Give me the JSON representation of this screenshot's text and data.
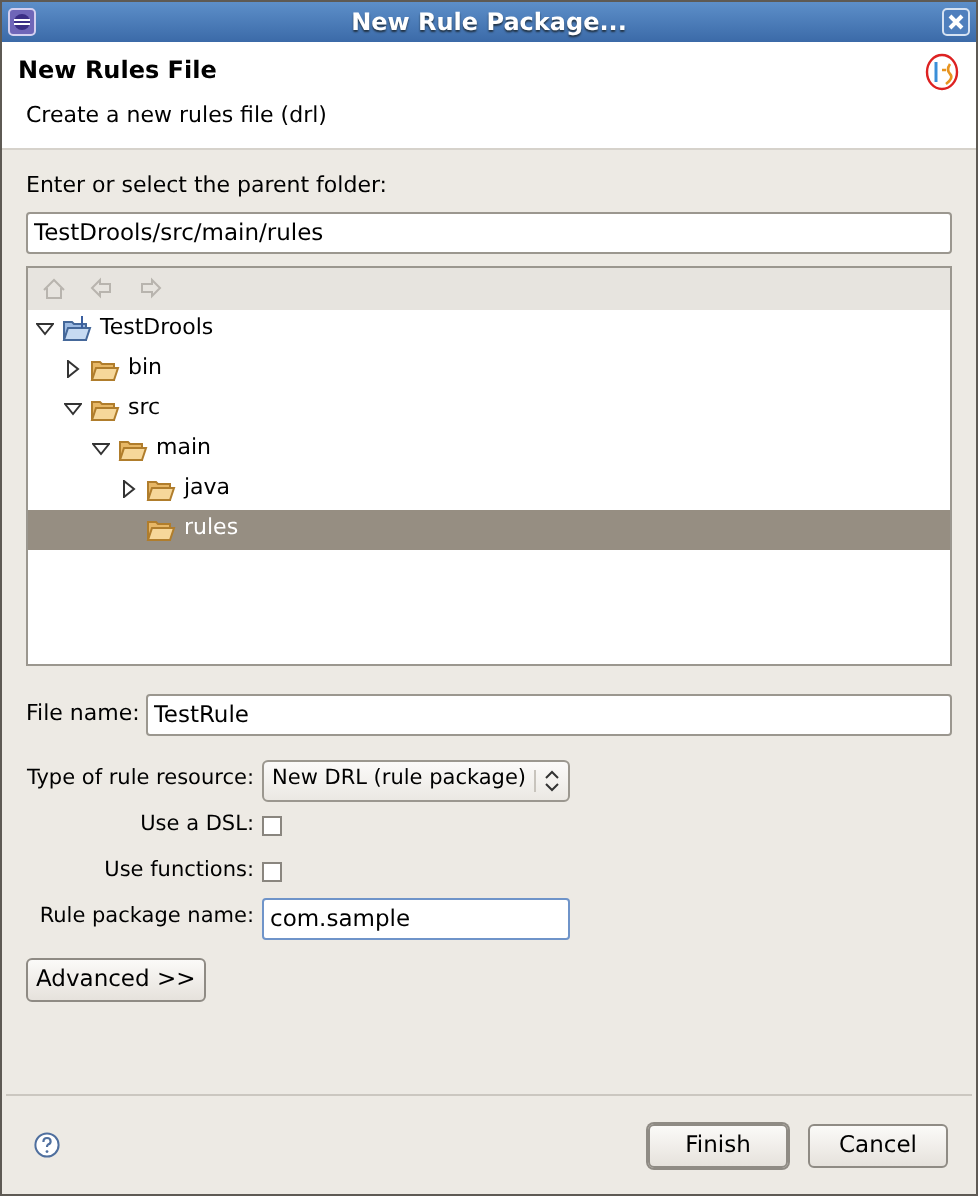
{
  "window": {
    "title": "New Rule Package..."
  },
  "header": {
    "title": "New Rules File",
    "description": "Create a new rules file (drl)"
  },
  "folder": {
    "label": "Enter or select the parent folder:",
    "value": "TestDrools/src/main/rules"
  },
  "tree": [
    {
      "label": "TestDrools",
      "kind": "project",
      "expanded": true,
      "selected": false,
      "children": [
        {
          "label": "bin",
          "kind": "folder",
          "expanded": false,
          "selected": false
        },
        {
          "label": "src",
          "kind": "folder",
          "expanded": true,
          "selected": false,
          "children": [
            {
              "label": "main",
              "kind": "folder",
              "expanded": true,
              "selected": false,
              "children": [
                {
                  "label": "java",
                  "kind": "folder",
                  "expanded": false,
                  "selected": false
                },
                {
                  "label": "rules",
                  "kind": "folder",
                  "selected": true
                }
              ]
            }
          ]
        }
      ]
    }
  ],
  "file_name": {
    "label": "File name:",
    "value": "TestRule"
  },
  "options": [
    {
      "kind": "select",
      "label": "Type of rule resource:",
      "value": "New DRL (rule package)"
    },
    {
      "kind": "checkbox",
      "label": "Use a DSL:",
      "checked": false
    },
    {
      "kind": "checkbox",
      "label": "Use functions:",
      "checked": false
    },
    {
      "kind": "text",
      "label": "Rule package name:",
      "value": "com.sample"
    }
  ],
  "advanced_button": "Advanced >>",
  "buttons": [
    {
      "label": "Finish",
      "default": true
    },
    {
      "label": "Cancel",
      "default": false
    }
  ]
}
